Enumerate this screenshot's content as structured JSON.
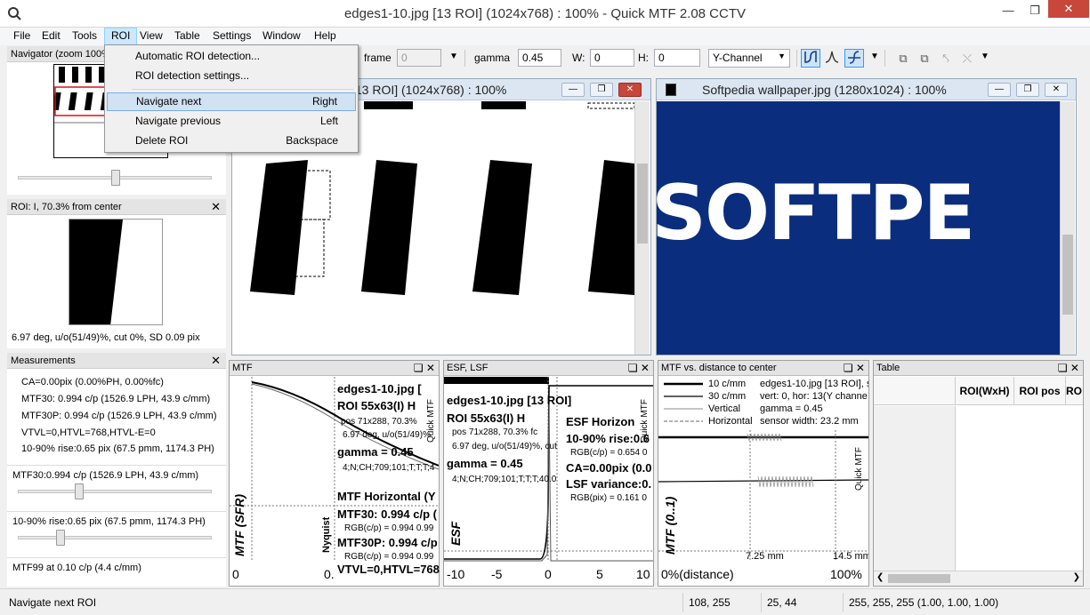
{
  "window": {
    "title": "edges1-10.jpg [13 ROI] (1024x768) : 100% - Quick MTF 2.08 CCTV"
  },
  "menubar": [
    "File",
    "Edit",
    "Tools",
    "ROI",
    "View",
    "Table",
    "Settings",
    "Window",
    "Help"
  ],
  "roi_menu": {
    "items": [
      {
        "label": "Automatic ROI detection...",
        "shortcut": ""
      },
      {
        "label": "ROI detection settings...",
        "shortcut": ""
      },
      {
        "label": "Navigate next",
        "shortcut": "Right"
      },
      {
        "label": "Navigate previous",
        "shortcut": "Left"
      },
      {
        "label": "Delete ROI",
        "shortcut": "Backspace"
      }
    ]
  },
  "toolbar": {
    "frame_label": "frame",
    "frame_value": "0",
    "gamma_label": "gamma",
    "gamma_value": "0.45",
    "w_label": "W:",
    "w_value": "0",
    "h_label": "H:",
    "h_value": "0",
    "channel": "Y-Channel"
  },
  "navigator": {
    "title": "Navigator (zoom 100%)"
  },
  "roi_panel": {
    "title": "ROI: I, 70.3% from center",
    "info": "6.97 deg, u/o(51/49)%, cut 0%, SD 0.09 pix"
  },
  "measurements": {
    "title": "Measurements",
    "lines": [
      "CA=0.00pix (0.00%PH, 0.00%fc)",
      "MTF30: 0.994 c/p (1526.9 LPH, 43.9 c/mm)",
      "MTF30P: 0.994 c/p (1526.9 LPH, 43.9 c/mm)",
      "VTVL=0,HTVL=768,HTVL-E=0",
      "10-90% rise:0.65 pix (67.5 pmm, 1174.3 PH)"
    ],
    "slider1_label": "MTF30:0.994 c/p (1526.9 LPH, 43.9 c/mm)",
    "slider2_label": "10-90% rise:0.65 pix (67.5 pmm, 1174.3 PH)",
    "mtf99_label": "MTF99 at 0.10 c/p (4.4 c/mm)"
  },
  "doc1": {
    "title": "[13 ROI] (1024x768) : 100%"
  },
  "doc2": {
    "title": "Softpedia wallpaper.jpg (1280x1024) : 100%",
    "logo_text": "SOFTPE"
  },
  "mtf_panel": {
    "title": "MTF",
    "lines": [
      "edges1-10.jpg [",
      "ROI 55x63(I) H",
      "pos 71x288, 70.3%",
      "6.97 deg, u/o(51/49)%",
      "gamma = 0.45",
      "4;N;CH;709;101;T;T;T;4",
      "MTF Horizontal (Y",
      "MTF30: 0.994 c/p (",
      "RGB(c/p) = 0.994 0.99",
      "MTF30P: 0.994 c/p",
      "RGB(c/p) = 0.994 0.99",
      "VTVL=0,HTVL=768"
    ],
    "ylabel": "MTF (SFR)",
    "nyquist": "Nyquist",
    "quick": "Quick MTF",
    "x_ticks": [
      "0",
      "0."
    ]
  },
  "esf_panel": {
    "title": "ESF, LSF",
    "lines": [
      "edges1-10.jpg [13 ROI]",
      "ROI 55x63(I) H",
      "pos 71x288, 70.3% fc",
      "6.97 deg, u/o(51/49)%, cut",
      "gamma = 0.45",
      "4;N;CH;709;101;T;T;T;40.0",
      "ESF Horizon",
      "10-90% rise:0.6",
      "RGB(c/p) = 0.654 0",
      "CA=0.00pix (0.0",
      "LSF variance:0.",
      "RGB(pix) = 0.161 0"
    ],
    "ylabel": "ESF",
    "quick": "Quick MTF",
    "x_ticks": [
      "-10",
      "-5",
      "0",
      "5",
      "10"
    ]
  },
  "dist_panel": {
    "title": "MTF vs. distance to center",
    "legend": [
      "10 c/mm",
      "30 c/mm",
      "Vertical",
      "Horizontal"
    ],
    "lines": [
      "edges1-10.jpg [13 ROI], s",
      "vert: 0, hor: 13(Y channe",
      "gamma = 0.45",
      "sensor width: 23.2 mm"
    ],
    "ylabel": "MTF (0..1)",
    "quick": "Quick MTF",
    "marks": [
      "7.25 mm",
      "14.5 mm"
    ],
    "x_ticks": [
      "0%(distance)",
      "100%"
    ]
  },
  "table_panel": {
    "title": "Table",
    "columns": [
      "ROI(WxH)",
      "ROI pos",
      "RO"
    ]
  },
  "status": {
    "message": "Navigate next ROI",
    "coords": "108, 255",
    "size": "25, 44",
    "rgb": "255, 255, 255 (1.00, 1.00, 1.00)"
  }
}
